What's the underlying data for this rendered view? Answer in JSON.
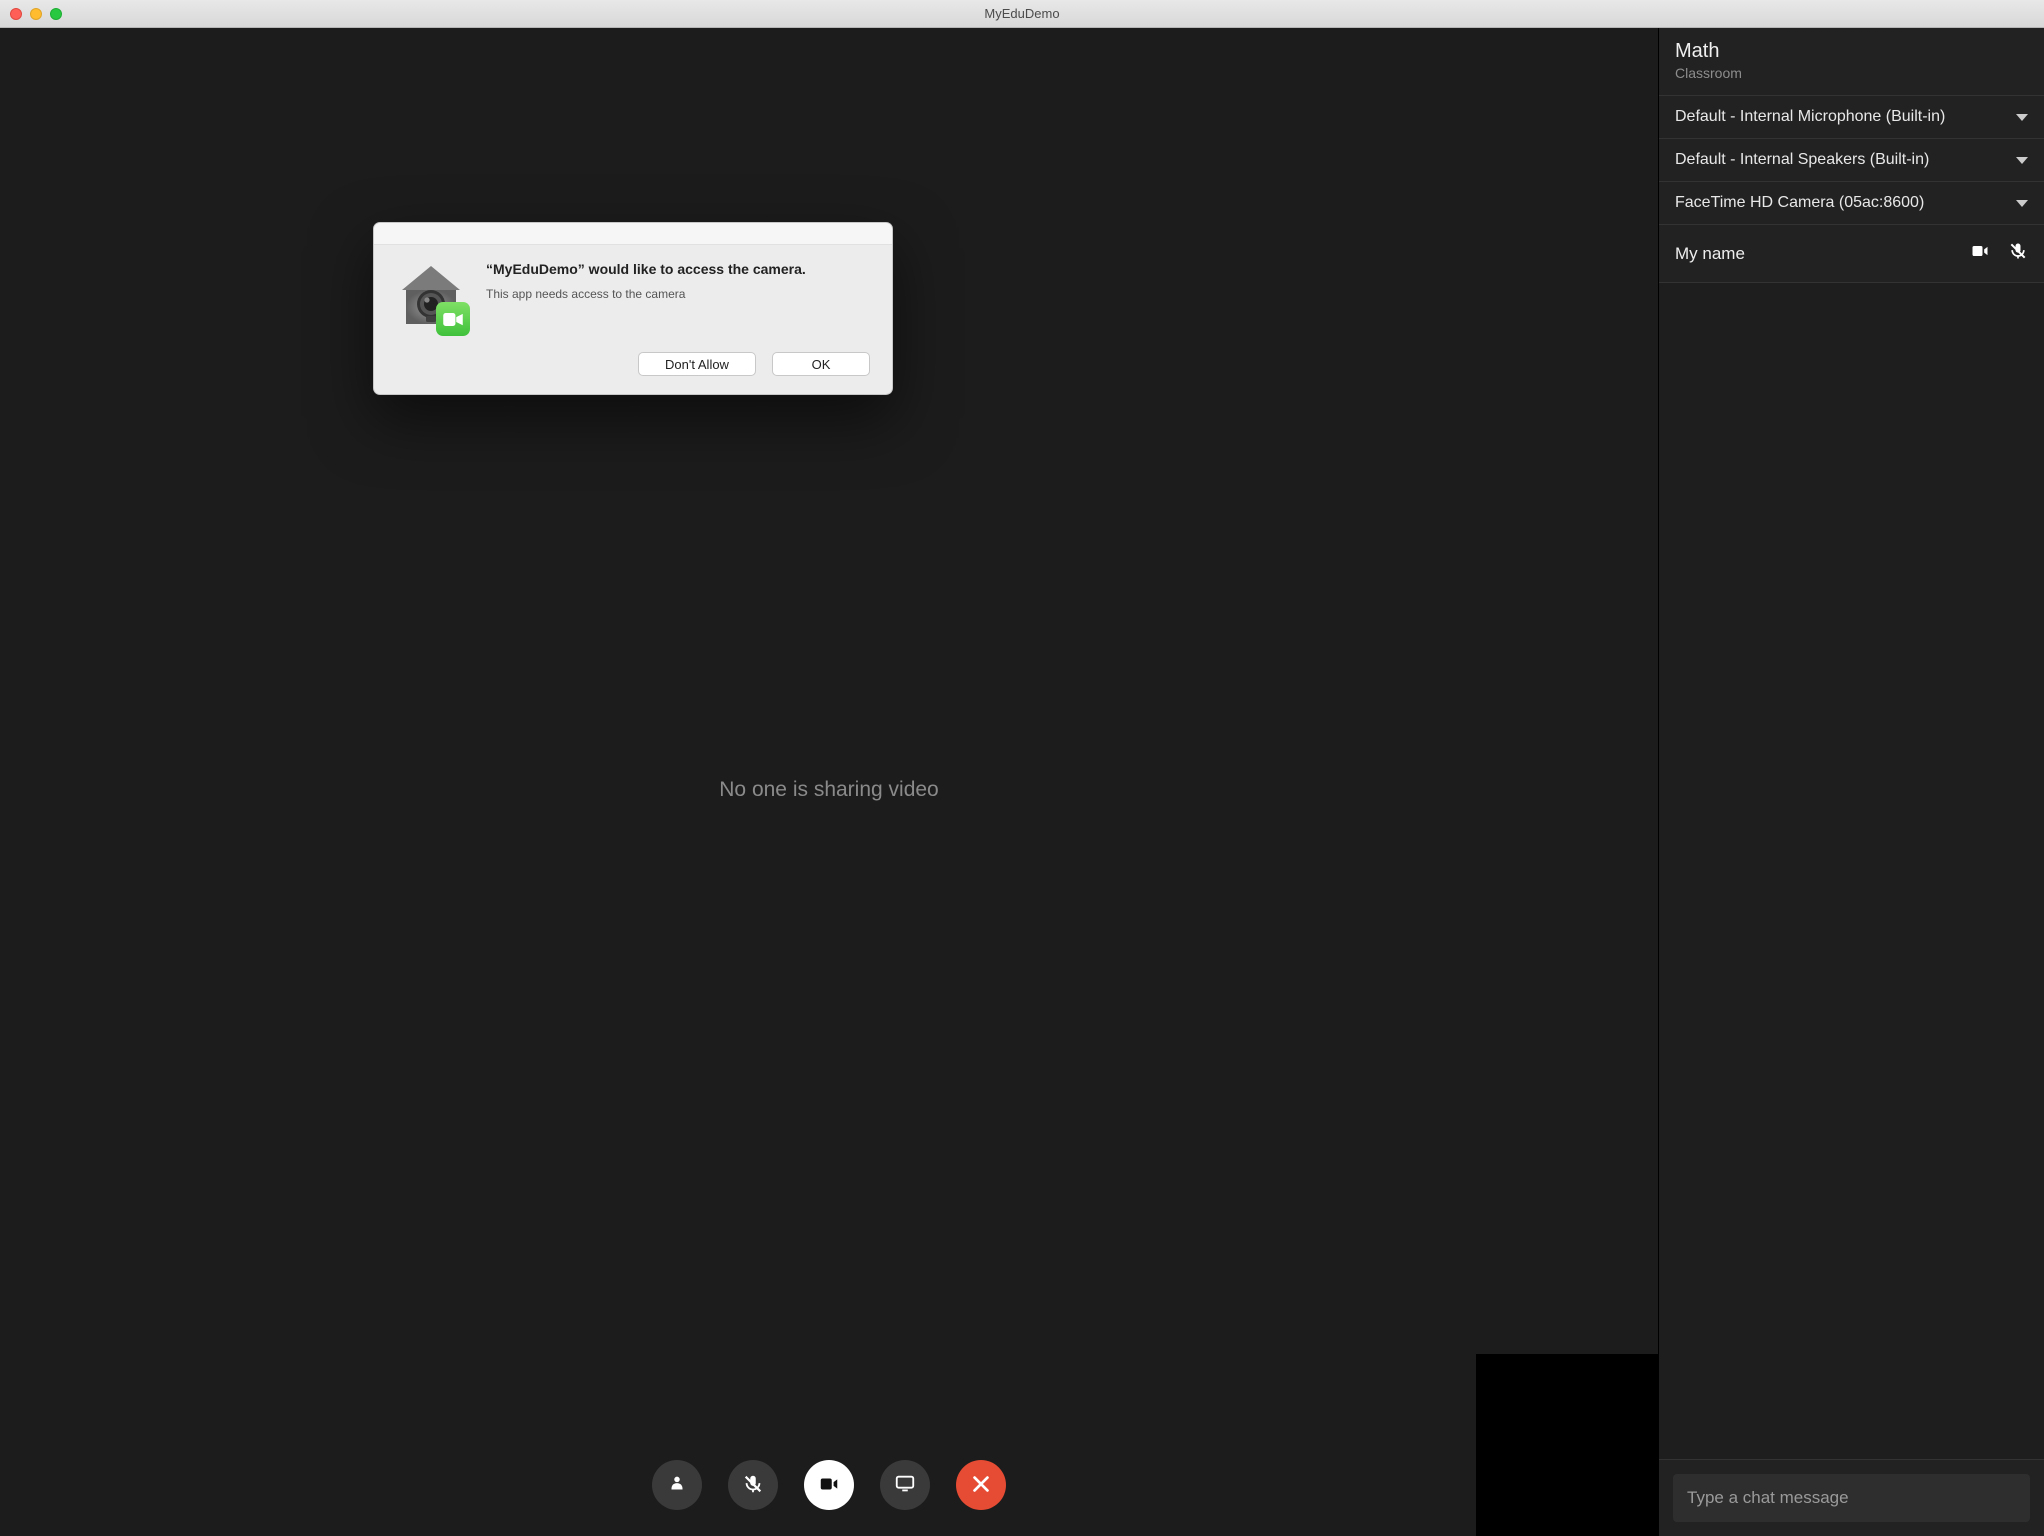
{
  "window": {
    "title": "MyEduDemo"
  },
  "main": {
    "no_video_text": "No one is sharing video"
  },
  "sidebar": {
    "title": "Math",
    "subtitle": "Classroom",
    "devices": {
      "mic": "Default - Internal Microphone (Built-in)",
      "speaker": "Default - Internal Speakers (Built-in)",
      "camera": "FaceTime HD Camera (05ac:8600)"
    },
    "participant": {
      "name": "My name"
    },
    "chat_placeholder": "Type a chat message"
  },
  "dialog": {
    "title": "“MyEduDemo” would like to access the camera.",
    "subtitle": "This app needs access to the camera",
    "deny_label": "Don't Allow",
    "ok_label": "OK"
  }
}
